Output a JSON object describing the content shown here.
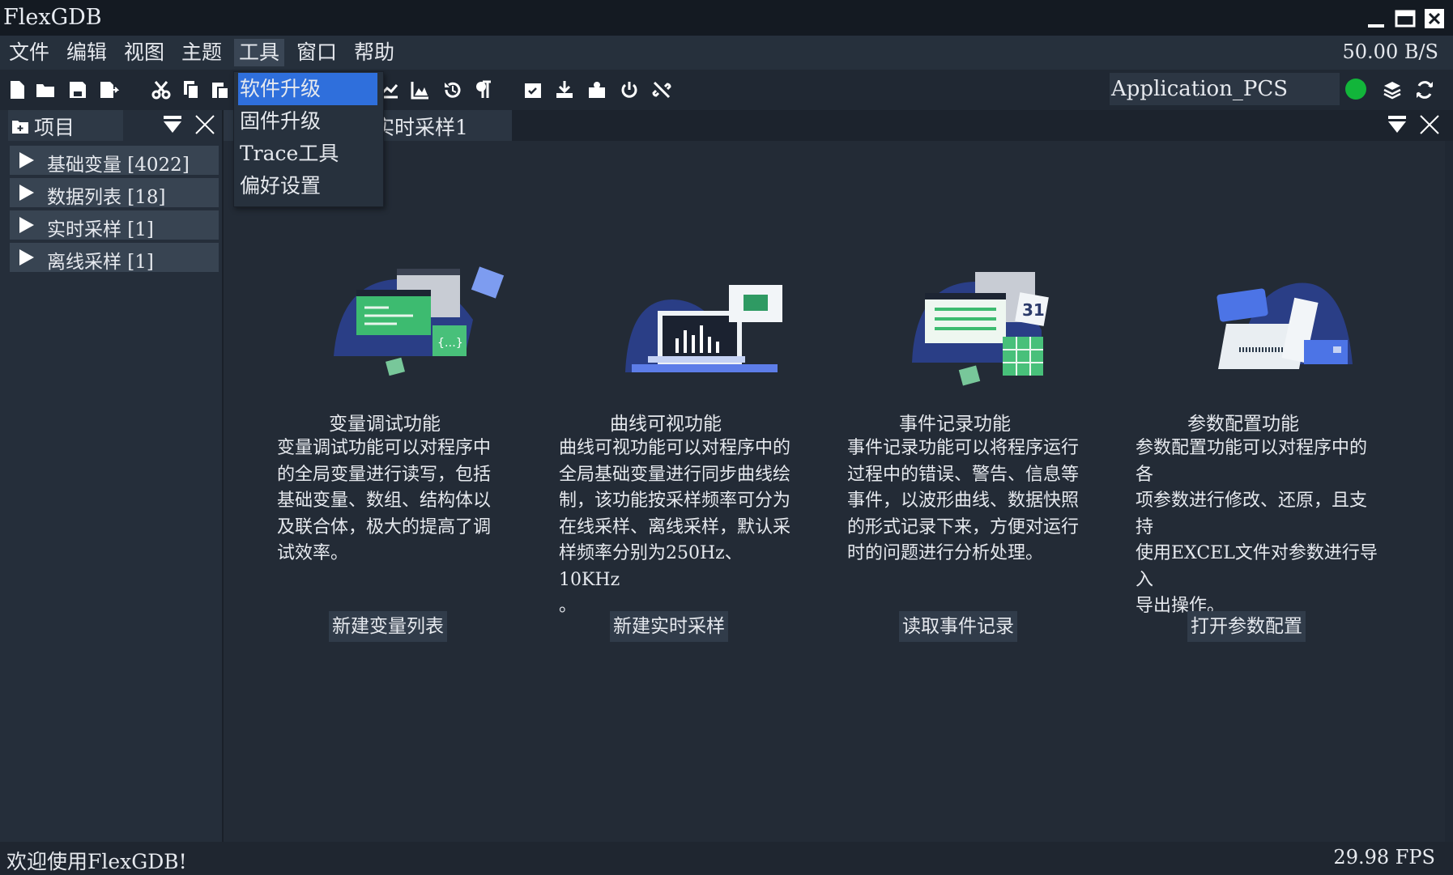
{
  "window": {
    "title": "FlexGDB"
  },
  "menubar": {
    "items": [
      "文件",
      "编辑",
      "视图",
      "主题",
      "工具",
      "窗口",
      "帮助"
    ],
    "rate": "50.00 B/S"
  },
  "tools_menu": {
    "items": [
      "软件升级",
      "固件升级",
      "Trace工具",
      "偏好设置"
    ]
  },
  "toolbar": {
    "app_select_value": "Application_PCS",
    "status_color": "#12b53a"
  },
  "left_panel": {
    "title": "项目",
    "items": [
      "基础变量 [4022]",
      "数据列表 [18]",
      "实时采样 [1]",
      "离线采样 [1]"
    ]
  },
  "doc_tab": {
    "label": "实时采样1"
  },
  "features": [
    {
      "title": "变量调试功能",
      "desc": "变量调试功能可以对程序中\n的全局变量进行读写，包括\n基础变量、数组、结构体以\n及联合体，极大的提高了调\n试效率。",
      "button": "新建变量列表"
    },
    {
      "title": "曲线可视功能",
      "desc": "曲线可视功能可以对程序中的\n全局基础变量进行同步曲线绘\n制，该功能按采样频率可分为\n在线采样、离线采样，默认采\n样频率分别为250Hz、10KHz\n。",
      "button": "新建实时采样"
    },
    {
      "title": "事件记录功能",
      "desc": "事件记录功能可以将程序运行\n过程中的错误、警告、信息等\n事件，以波形曲线、数据快照\n的形式记录下来，方便对运行\n时的问题进行分析处理。",
      "button": "读取事件记录"
    },
    {
      "title": "参数配置功能",
      "desc": "参数配置功能可以对程序中的各\n项参数进行修改、还原，且支持\n使用EXCEL文件对参数进行导入\n导出操作。",
      "button": "打开参数配置"
    }
  ],
  "statusbar": {
    "welcome": "欢迎使用FlexGDB!",
    "fps": "29.98 FPS"
  },
  "colors": {
    "accent": "#2f6fdc",
    "background": "#202833"
  }
}
